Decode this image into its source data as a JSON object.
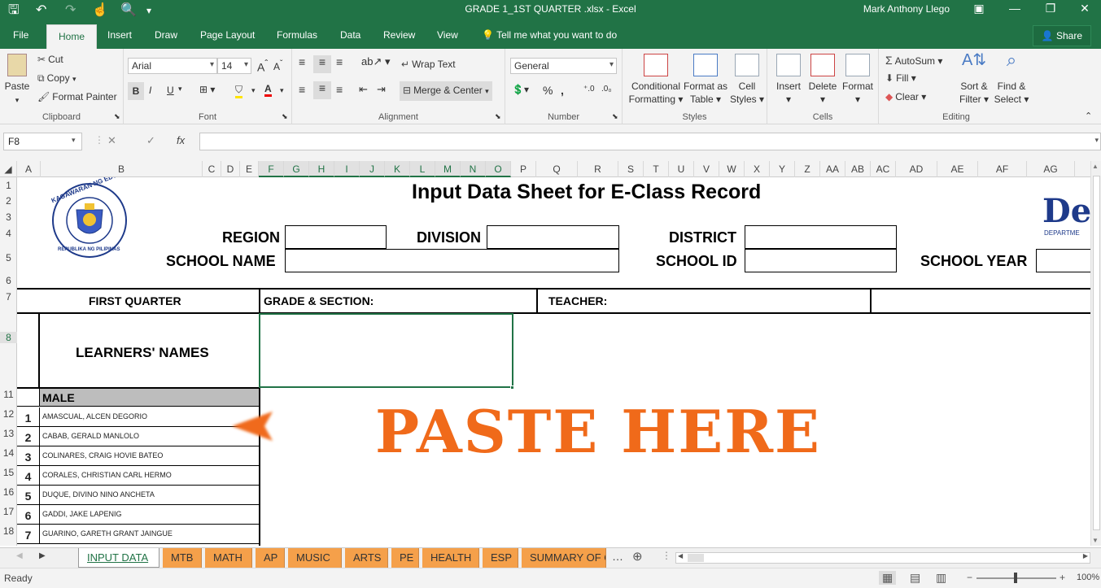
{
  "window": {
    "title": "GRADE 1_1ST QUARTER  .xlsx - Excel",
    "user": "Mark Anthony Llego"
  },
  "tabs": {
    "file": "File",
    "home": "Home",
    "insert": "Insert",
    "draw": "Draw",
    "page_layout": "Page Layout",
    "formulas": "Formulas",
    "data": "Data",
    "review": "Review",
    "view": "View",
    "tell_me": "Tell me what you want to do",
    "share": "Share"
  },
  "ribbon": {
    "clipboard": {
      "paste": "Paste",
      "cut": "Cut",
      "copy": "Copy",
      "format_painter": "Format Painter",
      "label": "Clipboard"
    },
    "font": {
      "name": "Arial",
      "size": "14",
      "label": "Font"
    },
    "alignment": {
      "wrap_text": "Wrap Text",
      "merge_center": "Merge & Center",
      "label": "Alignment"
    },
    "number": {
      "format": "General",
      "label": "Number"
    },
    "styles": {
      "conditional": "Conditional",
      "conditional2": "Formatting",
      "format_as": "Format as",
      "format_as2": "Table",
      "cell": "Cell",
      "cell2": "Styles",
      "label": "Styles"
    },
    "cells": {
      "insert": "Insert",
      "delete": "Delete",
      "format": "Format",
      "label": "Cells"
    },
    "editing": {
      "autosum": "AutoSum",
      "fill": "Fill",
      "clear": "Clear",
      "sort": "Sort &",
      "sort2": "Filter",
      "find": "Find &",
      "find2": "Select",
      "label": "Editing"
    }
  },
  "formula_bar": {
    "name_box": "F8",
    "formula": ""
  },
  "columns": [
    "A",
    "B",
    "C",
    "D",
    "E",
    "F",
    "G",
    "H",
    "I",
    "J",
    "K",
    "L",
    "M",
    "N",
    "O",
    "P",
    "Q",
    "R",
    "S",
    "T",
    "U",
    "V",
    "W",
    "X",
    "Y",
    "Z",
    "AA",
    "AB",
    "AC",
    "AD",
    "AE",
    "AF",
    "AG"
  ],
  "rows": [
    "1",
    "2",
    "3",
    "4",
    "5",
    "6",
    "7",
    "8",
    "11",
    "12",
    "13",
    "14",
    "15",
    "16",
    "17",
    "18"
  ],
  "sheet": {
    "logo_text": "KAGAWARAN NG EDUKASYON",
    "logo_text2": "REPUBLIKA NG PILIPINAS",
    "title": "Input Data Sheet for E-Class Record",
    "deped": "De",
    "deped_sub": "DEPARTME",
    "region": "REGION",
    "division": "DIVISION",
    "district": "DISTRICT",
    "school_name": "SCHOOL NAME",
    "school_id": "SCHOOL ID",
    "school_year": "SCHOOL YEAR",
    "first_quarter": "FIRST QUARTER",
    "grade_section": "GRADE & SECTION:",
    "teacher": "TEACHER:",
    "learners_names": "LEARNERS' NAMES",
    "male": "MALE",
    "paste_here": "PASTE HERE",
    "learners": [
      {
        "num": "1",
        "name": "AMASCUAL, ALCEN DEGORIO"
      },
      {
        "num": "2",
        "name": "CABAB, GERALD MANLOLO"
      },
      {
        "num": "3",
        "name": "COLINARES, CRAIG HOVIE BATEO"
      },
      {
        "num": "4",
        "name": "CORALES, CHRISTIAN CARL HERMO"
      },
      {
        "num": "5",
        "name": "DUQUE, DIVINO NINO ANCHETA"
      },
      {
        "num": "6",
        "name": "GADDI, JAKE LAPENIG"
      },
      {
        "num": "7",
        "name": "GUARINO, GARETH GRANT JAINGUE"
      }
    ]
  },
  "sheet_tabs": [
    "INPUT DATA",
    "MTB",
    "MATH",
    "AP",
    "MUSIC",
    "ARTS",
    "PE",
    "HEALTH",
    "ESP",
    "SUMMARY OF Q"
  ],
  "status": {
    "ready": "Ready",
    "zoom": "100%"
  },
  "colors": {
    "excel_green": "#217346",
    "tab_orange": "#f5a04a",
    "paste_orange": "#f06a1a"
  }
}
